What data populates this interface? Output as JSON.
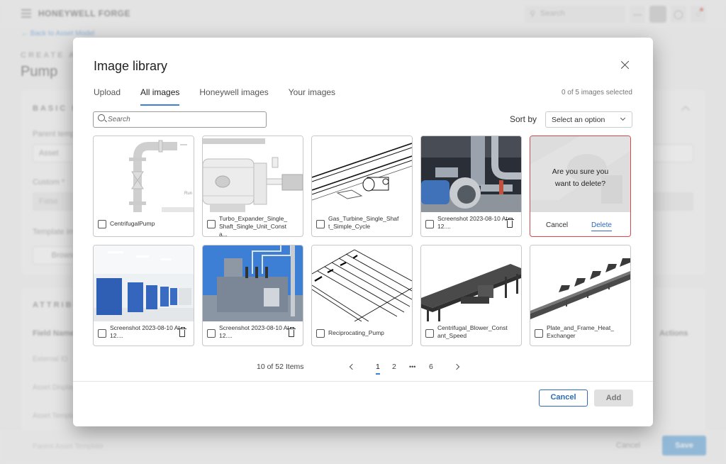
{
  "app": {
    "brand": "HONEYWELL FORGE",
    "search_placeholder": "Search",
    "back_link": "Back to Asset Model",
    "create_label": "CREATE ASSET TEMPLATE",
    "page_title": "Pump"
  },
  "background": {
    "basic_info_heading": "BASIC INFORMATION",
    "parent_template_label": "Parent template",
    "parent_template_value": "Asset",
    "custom_label": "Custom *",
    "custom_value": "False",
    "template_image_label": "Template image",
    "browse_button": "Browse",
    "attributes_heading": "ATTRIBUTES",
    "attr_columns": [
      "Field Name",
      "Actions"
    ],
    "attr_rows": [
      "External ID",
      "Asset Display Name",
      "Asset Template",
      "Parent Asset Template"
    ],
    "cancel_button": "Cancel",
    "save_button": "Save"
  },
  "modal": {
    "title": "Image library",
    "tabs": [
      {
        "label": "Upload",
        "active": false
      },
      {
        "label": "All images",
        "active": true
      },
      {
        "label": "Honeywell images",
        "active": false
      },
      {
        "label": "Your images",
        "active": false
      }
    ],
    "selection_count": "0 of 5 images selected",
    "search_placeholder": "Search",
    "sort_label": "Sort by",
    "sort_value": "Select an option",
    "images": [
      {
        "name": "CentrifugalPump",
        "deletable": false,
        "thumb": "pump-diagram"
      },
      {
        "name": "Turbo_Expander_Single_Shaft_Single_Unit_Consta...",
        "deletable": false,
        "thumb": "motor-diagram"
      },
      {
        "name": "Gas_Turbine_Single_Shaft_Simple_Cycle",
        "deletable": false,
        "thumb": "rail-drawing"
      },
      {
        "name": "Screenshot 2023-08-10 At 12....",
        "deletable": true,
        "thumb": "industrial-pump-photo"
      },
      {
        "name": "",
        "deletable": true,
        "thumb": "grey-machine-photo",
        "confirm_delete": true
      },
      {
        "name": "Screenshot 2023-08-10 At 12....",
        "deletable": true,
        "thumb": "cleanroom-photo"
      },
      {
        "name": "Screenshot 2023-08-10 At 12....",
        "deletable": true,
        "thumb": "substation-photo"
      },
      {
        "name": "Reciprocating_Pump",
        "deletable": false,
        "thumb": "roller-drawing"
      },
      {
        "name": "Centrifugal_Blower_Constant_Speed",
        "deletable": false,
        "thumb": "conveyor-3d"
      },
      {
        "name": "Plate_and_Frame_Heat_Exchanger",
        "deletable": false,
        "thumb": "chain-conveyor-3d"
      }
    ],
    "confirm": {
      "message_line1": "Are you sure you",
      "message_line2": "want to delete?",
      "cancel": "Cancel",
      "delete": "Delete"
    },
    "pagination": {
      "items_text": "10 of 52 Items",
      "pages": [
        "1",
        "2",
        "•••",
        "6"
      ],
      "current": "1"
    },
    "footer": {
      "cancel": "Cancel",
      "add": "Add"
    }
  }
}
